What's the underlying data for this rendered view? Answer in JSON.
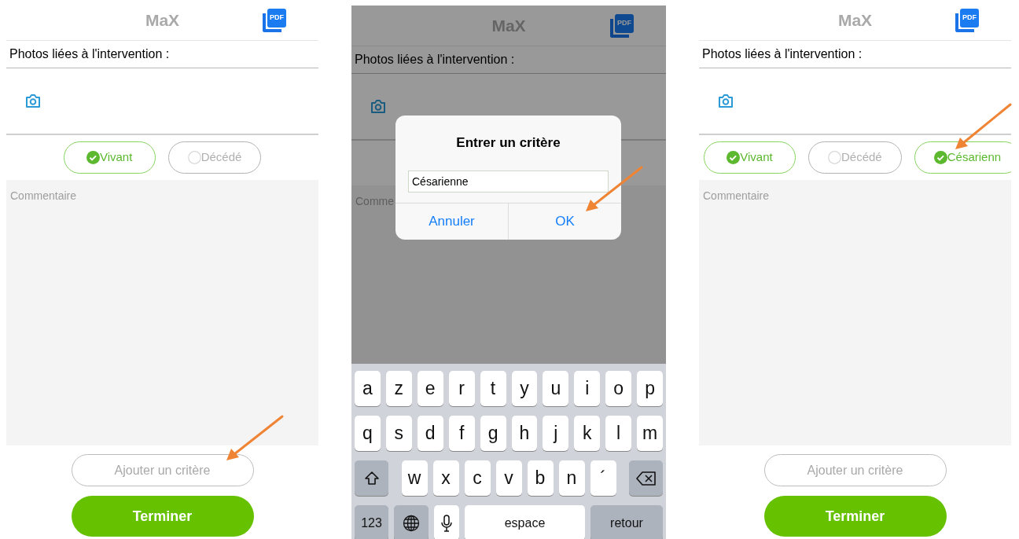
{
  "screens": [
    {
      "title": "MaX",
      "export_label": "PDF",
      "photos_label": "Photos liées à l'intervention :",
      "criteria": [
        {
          "label": "Vivant",
          "selected": true
        },
        {
          "label": "Décédé",
          "selected": false
        }
      ],
      "comment_placeholder": "Commentaire",
      "add_button": "Ajouter un critère",
      "finish_button": "Terminer"
    },
    {
      "title": "MaX",
      "export_label": "PDF",
      "photos_label": "Photos liées à l'intervention :",
      "comment_placeholder": "Comme",
      "dialog": {
        "title": "Entrer un critère",
        "value": "Césarienne",
        "buttons": [
          "Annuler",
          "OK"
        ]
      },
      "keyboard": [
        [
          {
            "kind": "letter",
            "label": "a"
          },
          {
            "kind": "letter",
            "label": "z"
          },
          {
            "kind": "letter",
            "label": "e"
          },
          {
            "kind": "letter",
            "label": "r"
          },
          {
            "kind": "letter",
            "label": "t"
          },
          {
            "kind": "letter",
            "label": "y"
          },
          {
            "kind": "letter",
            "label": "u"
          },
          {
            "kind": "letter",
            "label": "i"
          },
          {
            "kind": "letter",
            "label": "o"
          },
          {
            "kind": "letter",
            "label": "p"
          }
        ],
        [
          {
            "kind": "letter",
            "label": "q"
          },
          {
            "kind": "letter",
            "label": "s"
          },
          {
            "kind": "letter",
            "label": "d"
          },
          {
            "kind": "letter",
            "label": "f"
          },
          {
            "kind": "letter",
            "label": "g"
          },
          {
            "kind": "letter",
            "label": "h"
          },
          {
            "kind": "letter",
            "label": "j"
          },
          {
            "kind": "letter",
            "label": "k"
          },
          {
            "kind": "letter",
            "label": "l"
          },
          {
            "kind": "letter",
            "label": "m"
          }
        ],
        [
          {
            "kind": "shift"
          },
          {
            "kind": "letter",
            "label": "w"
          },
          {
            "kind": "letter",
            "label": "x"
          },
          {
            "kind": "letter",
            "label": "c"
          },
          {
            "kind": "letter",
            "label": "v"
          },
          {
            "kind": "letter",
            "label": "b"
          },
          {
            "kind": "letter",
            "label": "n"
          },
          {
            "kind": "letter",
            "label": "´"
          },
          {
            "kind": "backspace"
          }
        ],
        [
          {
            "kind": "numbers",
            "label": "123"
          },
          {
            "kind": "globe"
          },
          {
            "kind": "mic"
          },
          {
            "kind": "space",
            "label": "espace"
          },
          {
            "kind": "return",
            "label": "retour"
          }
        ]
      ]
    },
    {
      "title": "MaX",
      "export_label": "PDF",
      "photos_label": "Photos liées à l'intervention :",
      "criteria": [
        {
          "label": "Vivant",
          "selected": true
        },
        {
          "label": "Décédé",
          "selected": false
        },
        {
          "label": "Césarienn",
          "selected": true
        }
      ],
      "comment_placeholder": "Commentaire",
      "add_button": "Ajouter un critère",
      "finish_button": "Terminer"
    }
  ]
}
